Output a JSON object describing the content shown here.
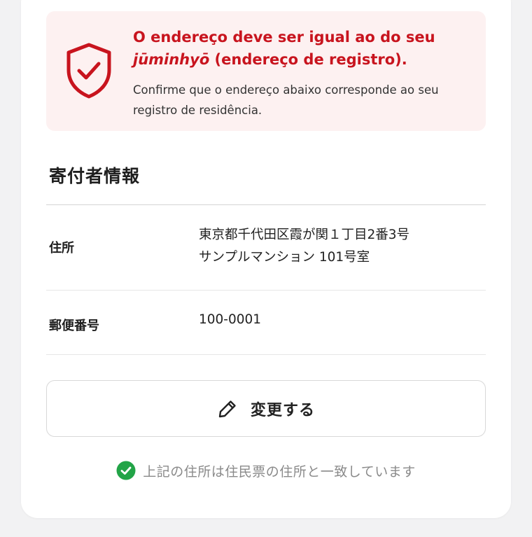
{
  "alert": {
    "icon": "shield-check-icon",
    "title_before": "O endereço deve ser igual ao do seu ",
    "title_emphasis": "jūminhyō",
    "title_after": " (endereço de registro).",
    "body": "Confirme que o endereço abaixo corresponde ao seu registro de residência.",
    "accent_color": "#c8141e",
    "background_color": "#fdf1f1"
  },
  "donor_info": {
    "section_title": "寄付者情報",
    "address": {
      "label": "住所",
      "line1": "東京都千代田区霞が関１丁目2番3号",
      "line2": "サンプルマンション 101号室"
    },
    "postal_code": {
      "label": "郵便番号",
      "value": "100-0001"
    }
  },
  "change_button": {
    "label": "変更する",
    "icon": "pencil-icon"
  },
  "confirmation": {
    "icon": "check-circle-icon",
    "text": "上記の住所は住民票の住所と一致しています",
    "icon_color": "#22a447"
  }
}
